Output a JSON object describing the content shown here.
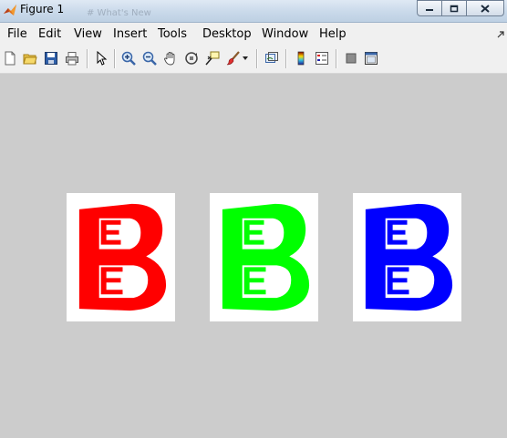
{
  "window": {
    "title": "Figure 1",
    "background_title": "# What's New"
  },
  "menu": [
    "File",
    "Edit",
    "View",
    "Insert",
    "Tools",
    "Desktop",
    "Window",
    "Help"
  ],
  "toolbar": {
    "items": [
      "new-figure-icon",
      "open-file-icon",
      "save-icon",
      "print-icon",
      "pointer-icon",
      "zoom-in-icon",
      "zoom-out-icon",
      "pan-icon",
      "rotate-3d-icon",
      "data-cursor-icon",
      "brush-icon",
      "link-plot-icon",
      "colorbar-icon",
      "legend-icon",
      "hide-plot-tools-icon",
      "show-plot-tools-icon"
    ]
  },
  "images": [
    {
      "name": "red-channel-image",
      "color": "#ff0000"
    },
    {
      "name": "green-channel-image",
      "color": "#00ff00"
    },
    {
      "name": "blue-channel-image",
      "color": "#0000ff"
    }
  ],
  "colors": {
    "figure_bg": "#cccccc",
    "menubar_bg": "#f0f0f0",
    "titlebar": "#c9d9ea"
  }
}
